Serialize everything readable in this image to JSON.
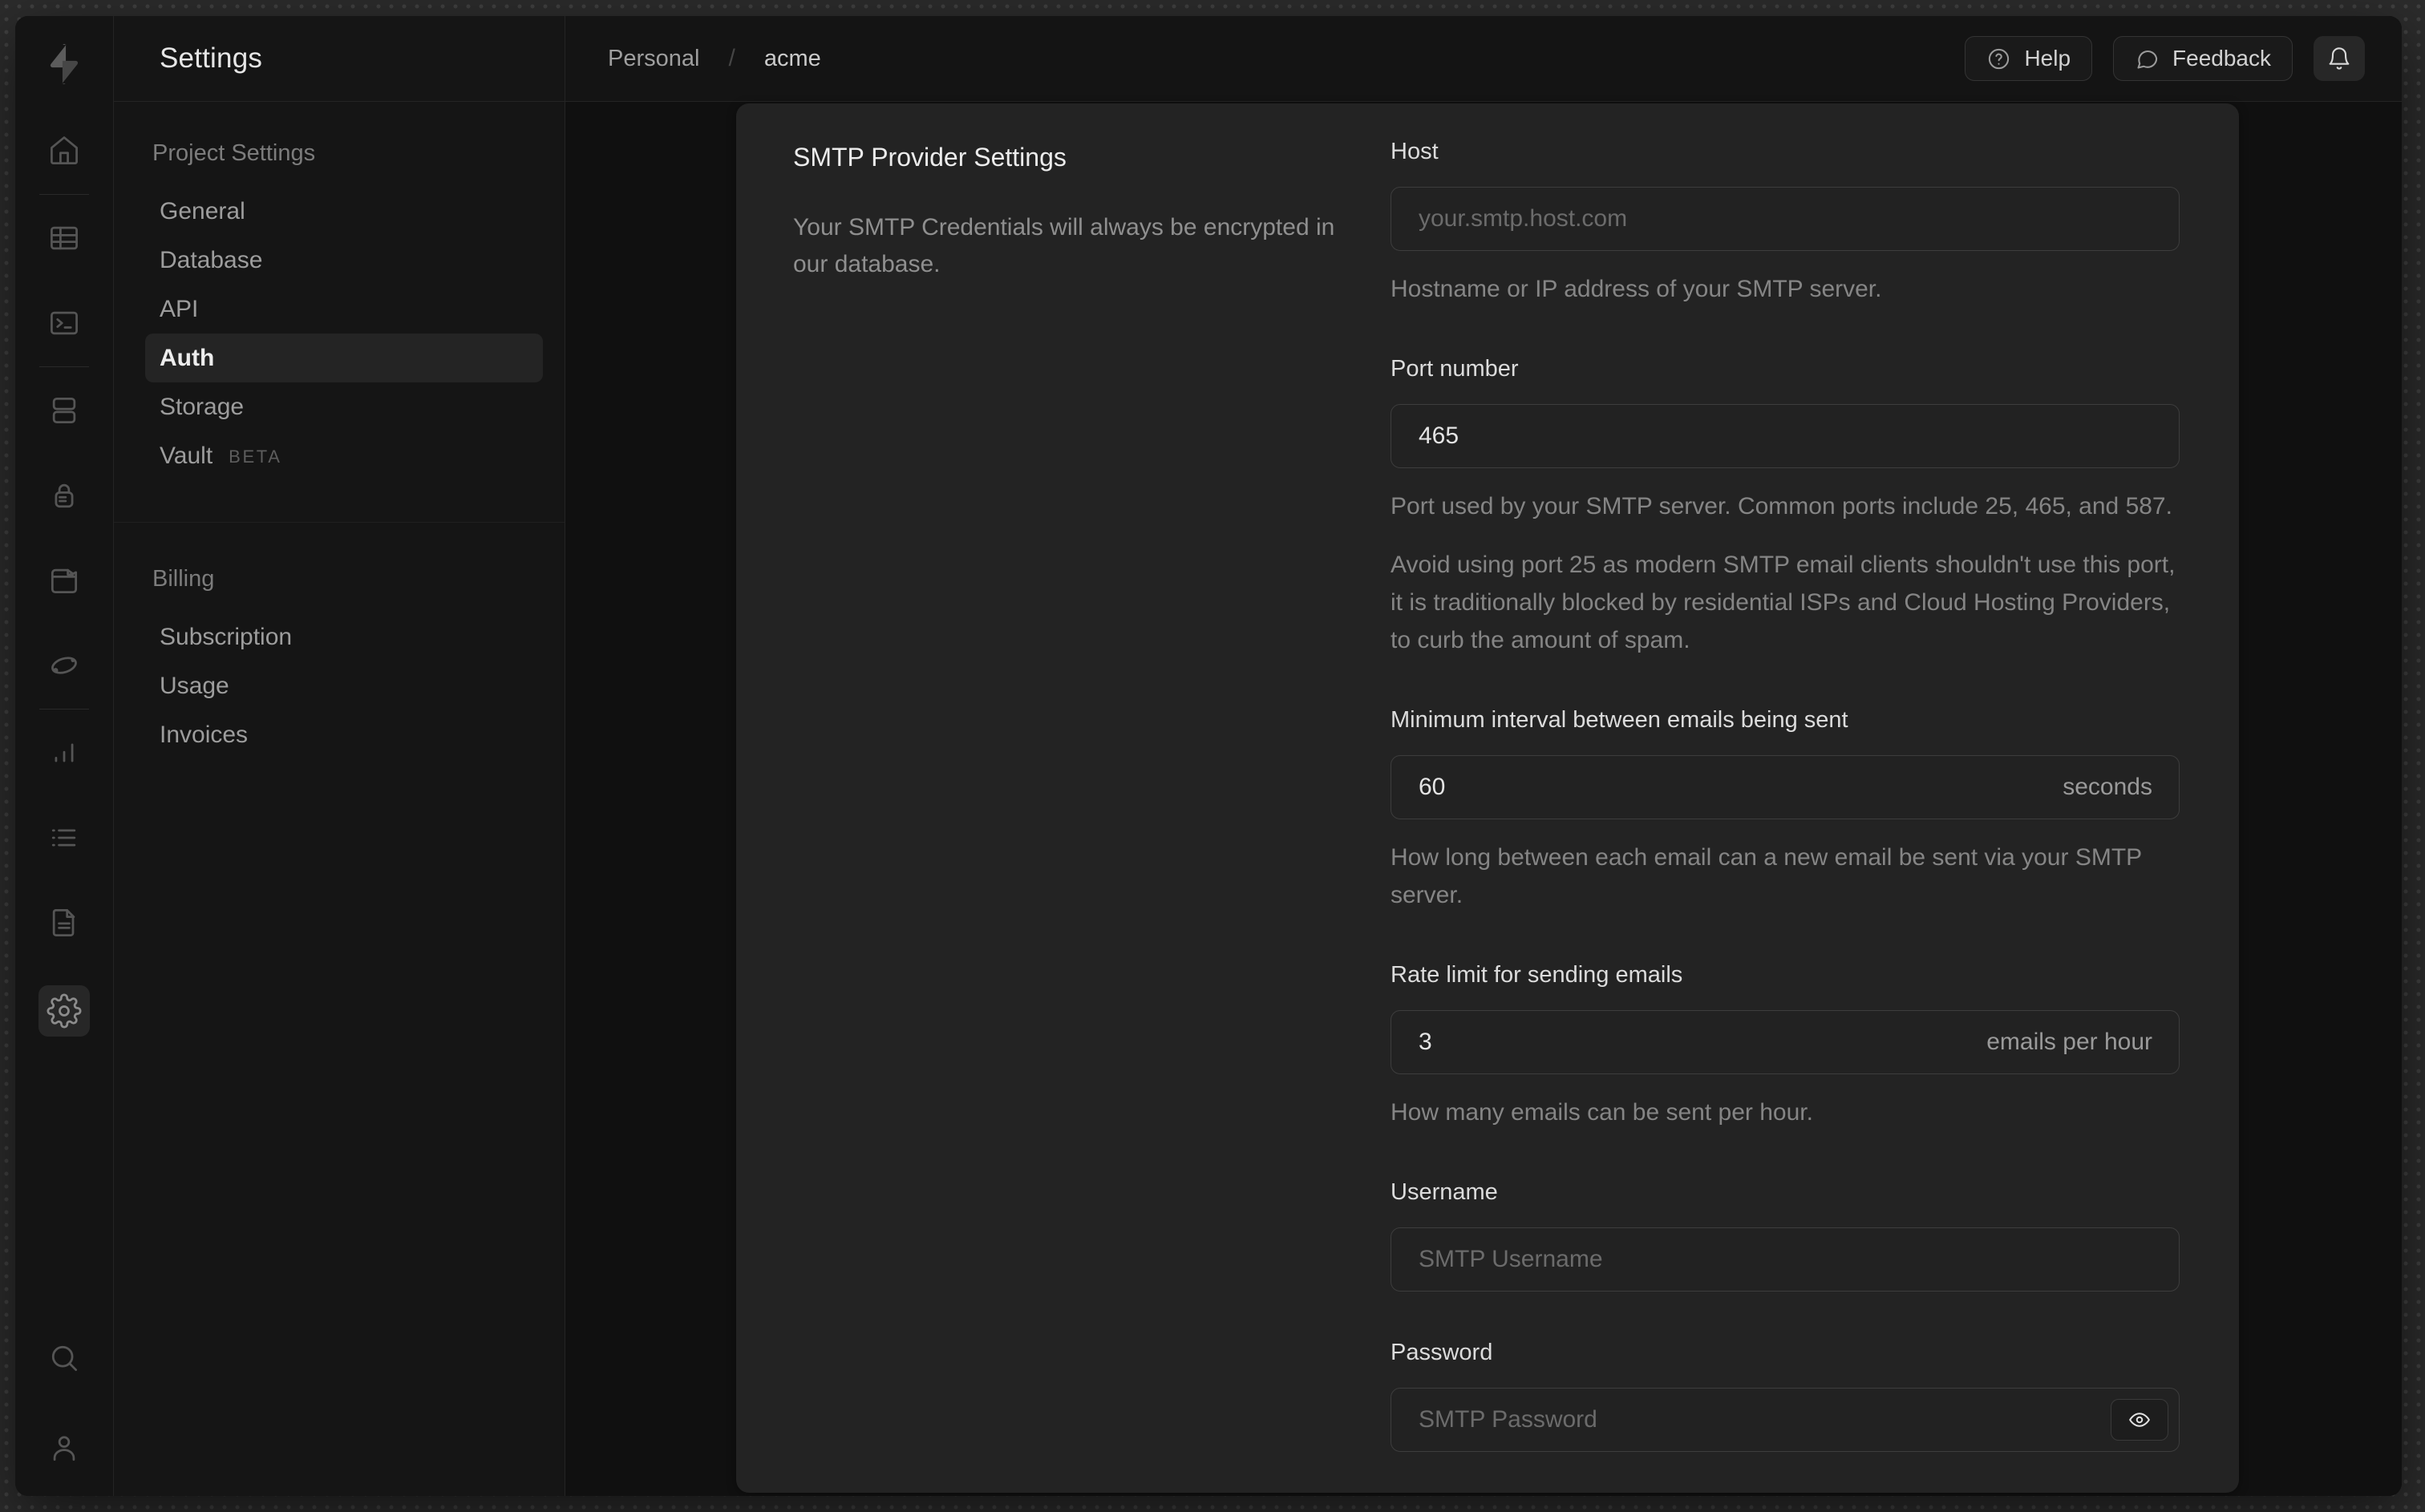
{
  "colors": {
    "desktop_bg": "#2c2c2c",
    "window_bg": "#141414",
    "content_bg": "#101010",
    "panel_bg": "#232323",
    "border": "#242424",
    "input_border": "#3d3d3d",
    "text_primary": "#ececec",
    "text_muted": "#8f8f8f",
    "placeholder": "#6b6b6b"
  },
  "rail": {
    "icons": [
      "home",
      "table-editor",
      "sql-editor",
      "database",
      "auth",
      "storage",
      "edge-functions",
      "reports",
      "logs",
      "docs",
      "settings",
      "search",
      "user"
    ]
  },
  "sidebar": {
    "title": "Settings",
    "groups": [
      {
        "heading": "Project Settings",
        "items": [
          {
            "label": "General"
          },
          {
            "label": "Database"
          },
          {
            "label": "API"
          },
          {
            "label": "Auth"
          },
          {
            "label": "Storage"
          },
          {
            "label": "Vault",
            "badge": "BETA"
          }
        ]
      },
      {
        "heading": "Billing",
        "items": [
          {
            "label": "Subscription"
          },
          {
            "label": "Usage"
          },
          {
            "label": "Invoices"
          }
        ]
      }
    ]
  },
  "header": {
    "breadcrumb": {
      "org": "Personal",
      "separator": "/",
      "project": "acme"
    },
    "actions": {
      "help": "Help",
      "feedback": "Feedback"
    }
  },
  "panel": {
    "title": "SMTP Provider Settings",
    "description": "Your SMTP Credentials will always be encrypted in our database.",
    "fields": [
      {
        "id": "host",
        "label": "Host",
        "placeholder": "your.smtp.host.com",
        "help": [
          "Hostname or IP address of your SMTP server."
        ]
      },
      {
        "id": "port",
        "label": "Port number",
        "value": "465",
        "help": [
          "Port used by your SMTP server. Common ports include 25, 465, and 587.",
          "Avoid using port 25 as modern SMTP email clients shouldn't use this port, it is traditionally blocked by residential ISPs and Cloud Hosting Providers, to curb the amount of spam."
        ]
      },
      {
        "id": "interval",
        "label": "Minimum interval between emails being sent",
        "value": "60",
        "suffix": "seconds",
        "help": [
          "How long between each email can a new email be sent via your SMTP server."
        ]
      },
      {
        "id": "rate-limit",
        "label": "Rate limit for sending emails",
        "value": "3",
        "suffix": "emails per hour",
        "help": [
          "How many emails can be sent per hour."
        ]
      },
      {
        "id": "username",
        "label": "Username",
        "placeholder": "SMTP Username"
      },
      {
        "id": "password",
        "label": "Password",
        "placeholder": "SMTP Password"
      }
    ]
  }
}
